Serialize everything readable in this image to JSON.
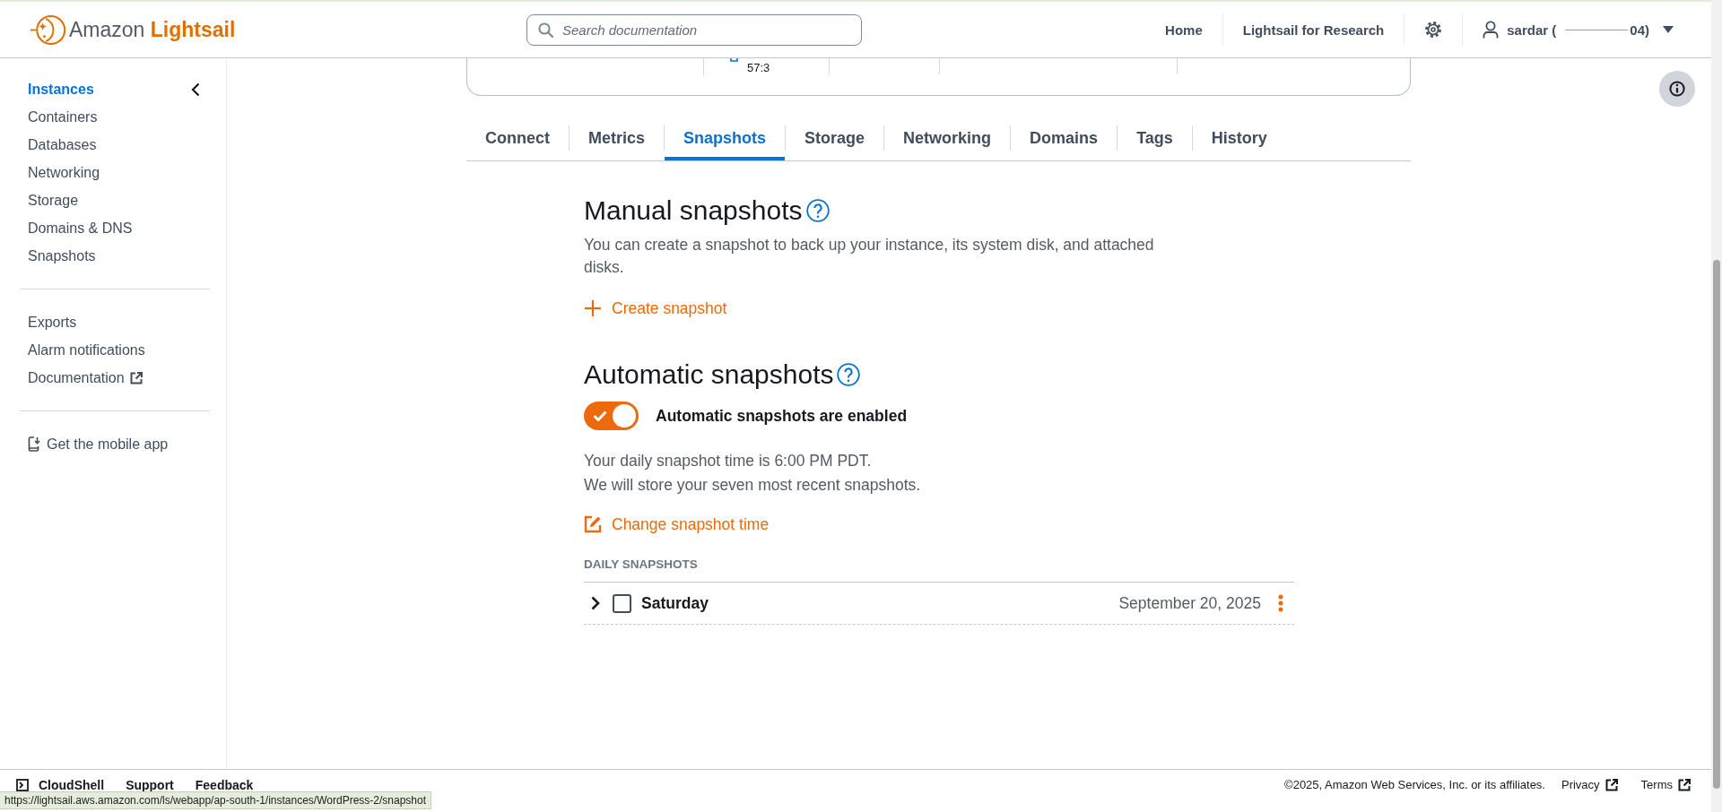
{
  "header": {
    "logo": {
      "brand": "Amazon",
      "product": "Lightsail"
    },
    "search": {
      "placeholder": "Search documentation"
    },
    "nav": [
      {
        "label": "Home"
      },
      {
        "label": "Lightsail for Research"
      }
    ],
    "user": {
      "name_start": "sardar (",
      "name_end": "04)"
    }
  },
  "sidebar": {
    "groups": [
      {
        "items": [
          {
            "label": "Instances",
            "kind": "link",
            "selected": true
          },
          {
            "label": "Containers",
            "kind": "link",
            "selected": false
          },
          {
            "label": "Databases",
            "kind": "link",
            "selected": false
          },
          {
            "label": "Networking",
            "kind": "link",
            "selected": false
          },
          {
            "label": "Storage",
            "kind": "link",
            "selected": false
          },
          {
            "label": "Domains & DNS",
            "kind": "link",
            "selected": false
          },
          {
            "label": "Snapshots",
            "kind": "link",
            "selected": false
          }
        ]
      },
      {
        "items": [
          {
            "label": "Exports",
            "kind": "link",
            "selected": false
          },
          {
            "label": "Alarm notifications",
            "kind": "link",
            "selected": false
          },
          {
            "label": "Documentation",
            "kind": "external",
            "selected": false
          }
        ]
      },
      {
        "items": [
          {
            "label": "Get the mobile app",
            "kind": "app",
            "selected": false
          }
        ]
      }
    ]
  },
  "summary_card": {
    "fragment": "57:3"
  },
  "tabs": [
    {
      "label": "Connect",
      "selected": false
    },
    {
      "label": "Metrics",
      "selected": false
    },
    {
      "label": "Snapshots",
      "selected": true
    },
    {
      "label": "Storage",
      "selected": false
    },
    {
      "label": "Networking",
      "selected": false
    },
    {
      "label": "Domains",
      "selected": false
    },
    {
      "label": "Tags",
      "selected": false
    },
    {
      "label": "History",
      "selected": false
    }
  ],
  "manual_snapshots": {
    "title": "Manual snapshots",
    "description": "You can create a snapshot to back up your instance, its system disk, and attached disks.",
    "action": "Create snapshot"
  },
  "automatic_snapshots": {
    "title": "Automatic snapshots",
    "toggle": {
      "on": true,
      "label": "Automatic snapshots are enabled"
    },
    "info_lines": [
      "Your daily snapshot time is 6:00 PM PDT.",
      "We will store your seven most recent snapshots."
    ],
    "action": "Change snapshot time",
    "list_title": "DAILY SNAPSHOTS",
    "rows": [
      {
        "name": "Saturday",
        "date": "September 20, 2025",
        "expanded": false,
        "checked": false
      }
    ]
  },
  "footer": {
    "links": [
      {
        "label": "CloudShell",
        "kind": "terminal"
      },
      {
        "label": "Support",
        "kind": "text"
      },
      {
        "label": "Feedback",
        "kind": "text"
      }
    ],
    "copyright": "©2025, Amazon Web Services, Inc. or its affiliates.",
    "legal_links": [
      {
        "label": "Privacy",
        "kind": "external"
      },
      {
        "label": "Terms",
        "kind": "external"
      }
    ]
  },
  "status_url": "https://lightsail.aws.amazon.com/ls/webapp/ap-south-1/instances/WordPress-2/snapshot"
}
